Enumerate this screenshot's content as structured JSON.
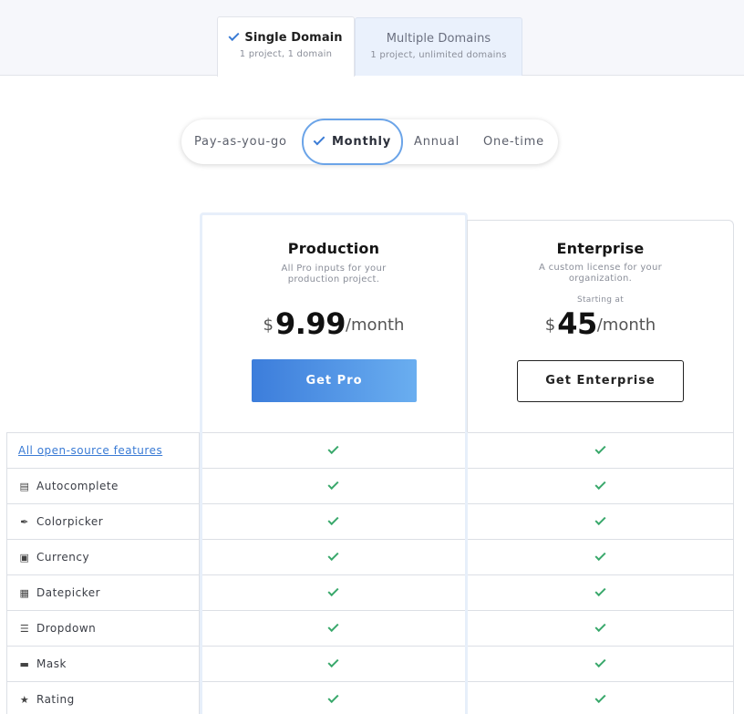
{
  "domain_tabs": [
    {
      "title": "Single Domain",
      "subtitle": "1 project, 1 domain",
      "selected": true
    },
    {
      "title": "Multiple Domains",
      "subtitle": "1 project, unlimited domains",
      "selected": false
    }
  ],
  "billing_options": [
    "Pay-as-you-go",
    "Monthly",
    "Annual",
    "One-time"
  ],
  "billing_selected": "Monthly",
  "plans": {
    "production": {
      "name": "Production",
      "description": "All Pro inputs for your production project.",
      "currency": "$",
      "amount": "9.99",
      "period": "/month",
      "button": "Get Pro"
    },
    "enterprise": {
      "name": "Enterprise",
      "description": "A custom license for your organization.",
      "starting_label": "Starting at",
      "currency": "$",
      "amount": "45",
      "period": "/month",
      "button": "Get Enterprise"
    }
  },
  "features": [
    {
      "label": "All open-source features",
      "icon": "",
      "link": true,
      "production": true,
      "enterprise": true
    },
    {
      "label": "Autocomplete",
      "icon": "autocomplete-icon",
      "link": false,
      "production": true,
      "enterprise": true
    },
    {
      "label": "Colorpicker",
      "icon": "eyedropper-icon",
      "link": false,
      "production": true,
      "enterprise": true
    },
    {
      "label": "Currency",
      "icon": "currency-icon",
      "link": false,
      "production": true,
      "enterprise": true
    },
    {
      "label": "Datepicker",
      "icon": "calendar-icon",
      "link": false,
      "production": true,
      "enterprise": true
    },
    {
      "label": "Dropdown",
      "icon": "dropdown-icon",
      "link": false,
      "production": true,
      "enterprise": true
    },
    {
      "label": "Mask",
      "icon": "mask-icon",
      "link": false,
      "production": true,
      "enterprise": true
    },
    {
      "label": "Rating",
      "icon": "star-icon",
      "link": false,
      "production": true,
      "enterprise": true
    }
  ],
  "colors": {
    "accent": "#3a7bd5",
    "check_green": "#39a86b",
    "button_gradient_start": "#3c7ddb",
    "button_gradient_end": "#6aaef0"
  }
}
